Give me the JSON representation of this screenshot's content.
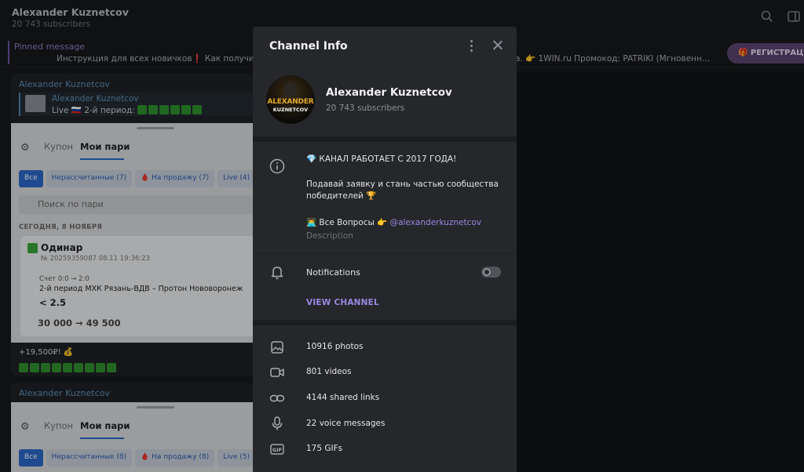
{
  "background": {
    "header": {
      "channel_title": "Alexander Kuznetcov",
      "subscribers": "20 743 subscribers"
    },
    "pinned": {
      "label": "Pinned message",
      "text_part1": "Инструкция для всех новичков❗ Как получит",
      "text_part2": "а. 👉 1WIN.ru  Промокод: PATRIKI (Мгновенн…",
      "register_button": "🎁 РЕГИСТРАЦ"
    },
    "message1": {
      "author": "Alexander Kuznetcov",
      "reply_name": "Alexander Kuznetcov",
      "reply_text": "Live 🇷🇺 2-й период:",
      "footer_text": "+19,500₽! 💰"
    },
    "message2": {
      "author": "Alexander Kuznetcov"
    },
    "bet_screenshot1": {
      "tab_coupon": "Купон",
      "tab_mine": "Мои пари",
      "chips": [
        "Все",
        "Нерассчитанные (7)",
        "🩸 На продажу (7)",
        "Live (4)"
      ],
      "search_placeholder": "Поиск по пари",
      "date": "СЕГОДНЯ, 8 НОЯБРЯ",
      "bet_type": "Одинар",
      "bet_id": "№ 20259359087   08.11   19:36:23",
      "score": "Счет 0:0 → 2:0",
      "match": "2-й период МХК Рязань-ВДВ – Протон Нововоронеж",
      "odds": "< 2.5",
      "amount": "30 000 → 49 500"
    },
    "bet_screenshot2": {
      "tab_coupon": "Купон",
      "tab_mine": "Мои пари",
      "chips": [
        "Все",
        "Нерассчитанные (8)",
        "🩸 На продажу (8)",
        "Live (5)"
      ]
    }
  },
  "modal": {
    "title": "Channel Info",
    "channel_name": "Alexander Kuznetcov",
    "subscribers": "20 743 subscribers",
    "avatar_logo_line1": "ALEXANDER",
    "avatar_logo_line2": "KUZNETCOV",
    "description": {
      "line1": "💎 КАНАЛ РАБОТАЕТ С 2017 ГОДА!",
      "line2": "Подавай заявку и стань частью сообщества победителей 🏆",
      "line3_prefix": "👨‍💻 Все Вопросы  👉 ",
      "line3_link": "@alexanderkuznetcov",
      "caption": "Description"
    },
    "notifications_label": "Notifications",
    "notifications_on": false,
    "view_channel": "VIEW CHANNEL",
    "stats": [
      {
        "icon": "photo-icon",
        "label": "10916 photos"
      },
      {
        "icon": "video-icon",
        "label": "801 videos"
      },
      {
        "icon": "link-icon",
        "label": "4144 shared links"
      },
      {
        "icon": "microphone-icon",
        "label": "22 voice messages"
      },
      {
        "icon": "gif-icon",
        "label": "175 GIFs"
      }
    ]
  },
  "colors": {
    "accent": "#9a88e0",
    "link_blue": "#5c8fb8",
    "modal_bg": "#25272b"
  }
}
